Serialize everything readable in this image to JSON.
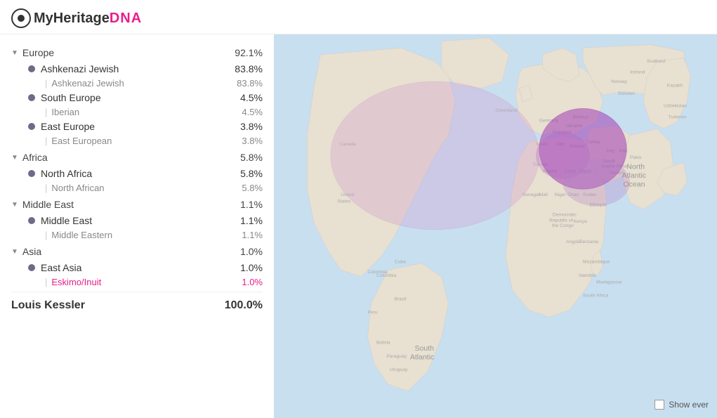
{
  "header": {
    "logo_text_my": "My",
    "logo_text_heritage": "Heritage",
    "logo_dna": "DNA"
  },
  "sidebar": {
    "categories": [
      {
        "name": "Europe",
        "pct": "92.1%",
        "expanded": true,
        "items": [
          {
            "name": "Ashkenazi Jewish",
            "pct": "83.8%",
            "sub": "Ashkenazi Jewish",
            "sub_pct": "83.8%"
          },
          {
            "name": "South Europe",
            "pct": "4.5%",
            "sub": "Iberian",
            "sub_pct": "4.5%"
          },
          {
            "name": "East Europe",
            "pct": "3.8%",
            "sub": "East European",
            "sub_pct": "3.8%"
          }
        ]
      },
      {
        "name": "Africa",
        "pct": "5.8%",
        "expanded": true,
        "items": [
          {
            "name": "North Africa",
            "pct": "5.8%",
            "sub": "North African",
            "sub_pct": "5.8%"
          }
        ]
      },
      {
        "name": "Middle East",
        "pct": "1.1%",
        "expanded": true,
        "items": [
          {
            "name": "Middle East",
            "pct": "1.1%",
            "sub": "Middle Eastern",
            "sub_pct": "1.1%"
          }
        ]
      },
      {
        "name": "Asia",
        "pct": "1.0%",
        "expanded": true,
        "items": [
          {
            "name": "East Asia",
            "pct": "1.0%",
            "sub": "Eskimo/Inuit",
            "sub_pct": "1.0%",
            "highlight": true
          }
        ]
      }
    ],
    "footer": {
      "name": "Louis Kessler",
      "pct": "100.0%"
    }
  },
  "map": {
    "show_ever_label": "Show ever"
  }
}
